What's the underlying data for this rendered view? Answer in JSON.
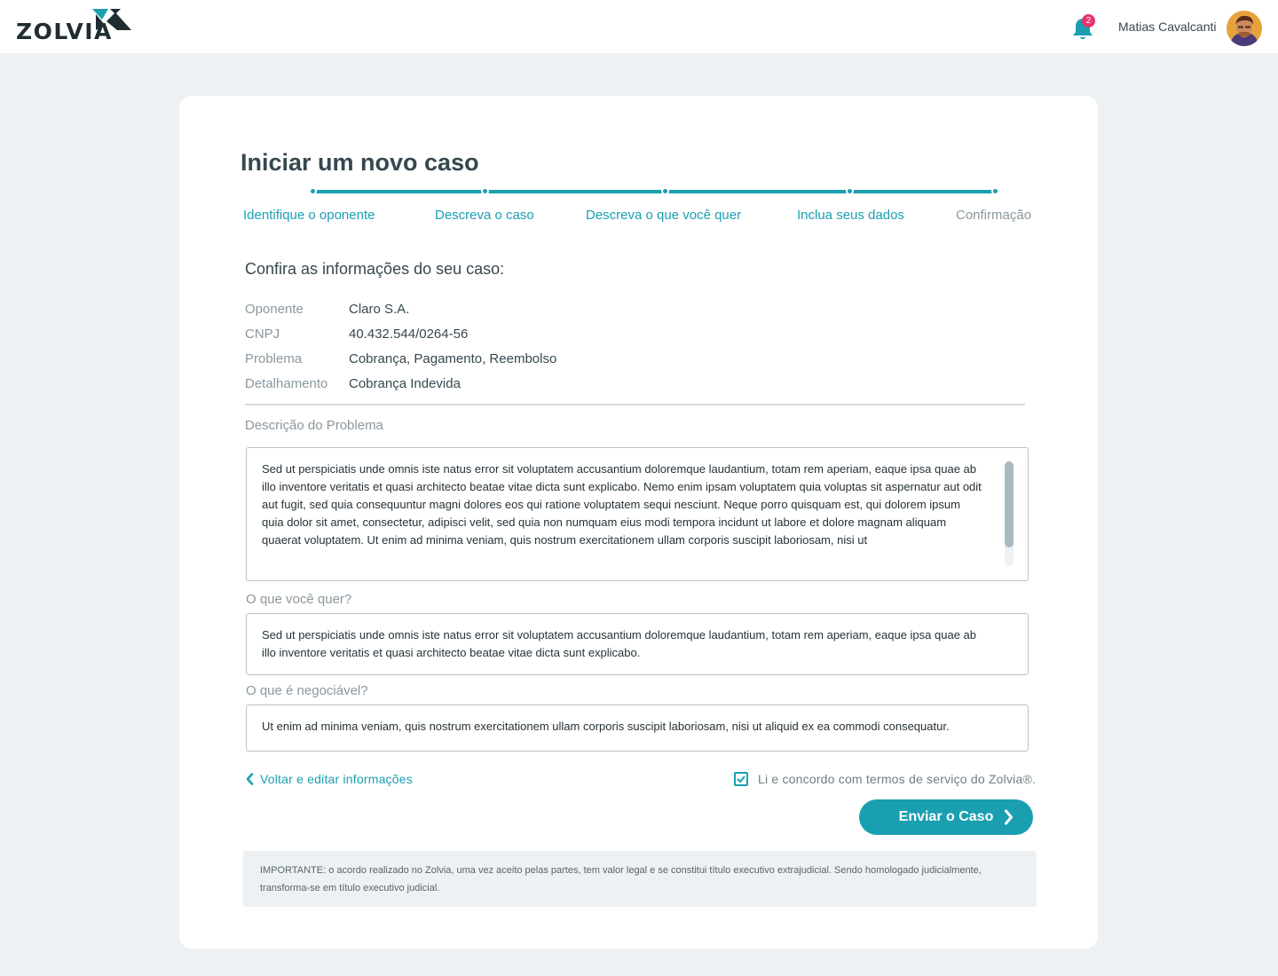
{
  "app": {
    "logo_text": "ZOLVIA"
  },
  "header": {
    "notifications_count": "2",
    "user_name": "Matias Cavalcanti"
  },
  "page": {
    "title": "Iniciar um novo caso",
    "subtitle": "Confira as informações do seu caso:"
  },
  "stepper": {
    "steps": [
      {
        "label": "Identifique o oponente",
        "state": "done"
      },
      {
        "label": "Descreva o caso",
        "state": "done"
      },
      {
        "label": "Descreva o que você quer",
        "state": "done"
      },
      {
        "label": "Inclua seus dados",
        "state": "done"
      },
      {
        "label": "Confirmação",
        "state": "current"
      }
    ]
  },
  "case_info": [
    {
      "key": "Oponente",
      "value": "Claro S.A."
    },
    {
      "key": "CNPJ",
      "value": "40.432.544/0264-56"
    },
    {
      "key": "Problema",
      "value": "Cobrança, Pagamento, Reembolso"
    },
    {
      "key": "Detalhamento",
      "value": "Cobrança Indevida"
    }
  ],
  "fields": {
    "description": {
      "label": "Descrição do Problema",
      "value": "Sed ut perspiciatis unde omnis iste natus error sit voluptatem accusantium doloremque laudantium, totam rem aperiam, eaque ipsa quae ab illo inventore veritatis et quasi architecto beatae vitae dicta sunt explicabo. Nemo enim ipsam voluptatem quia voluptas sit aspernatur aut odit aut fugit, sed quia consequuntur magni dolores eos qui ratione voluptatem sequi nesciunt. Neque porro quisquam est, qui dolorem ipsum quia dolor sit amet, consectetur, adipisci velit, sed quia non numquam eius modi tempora incidunt ut labore et dolore magnam aliquam quaerat voluptatem. Ut enim ad minima veniam, quis nostrum exercitationem ullam corporis suscipit laboriosam, nisi ut"
    },
    "wants": {
      "label": "O que você quer?",
      "value": "Sed ut perspiciatis unde omnis iste natus error sit voluptatem accusantium doloremque laudantium, totam rem aperiam, eaque ipsa quae ab illo inventore veritatis et quasi architecto beatae vitae dicta sunt explicabo."
    },
    "negotiable": {
      "label": "O que é negociável?",
      "value": "Ut enim ad minima veniam, quis nostrum exercitationem ullam corporis suscipit laboriosam, nisi ut aliquid ex ea commodi consequatur."
    }
  },
  "actions": {
    "back_label": "Voltar e editar informações",
    "terms_label": "Li e concordo com termos de serviço do Zolvia®.",
    "terms_checked": true,
    "submit_label": "Enviar o Caso"
  },
  "notice": {
    "text": "IMPORTANTE: o acordo realizado no Zolvia, uma vez aceito pelas partes, tem valor legal e se constitui título executivo extrajudicial. Sendo homologado judicialmente, transforma-se em título executivo judicial."
  },
  "colors": {
    "accent": "#1a9fb1",
    "badge": "#e8336b",
    "background": "#eef1f3"
  },
  "icons": [
    "logo-mark-icon",
    "bell-icon",
    "chevron-left-icon",
    "checkmark-icon",
    "chevron-right-icon"
  ]
}
